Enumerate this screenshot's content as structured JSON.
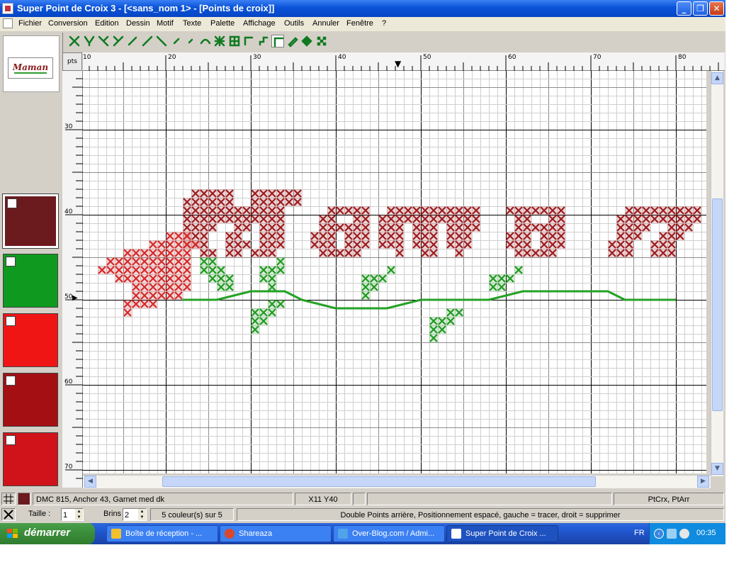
{
  "window": {
    "title": "Super Point de Croix 3 - [<sans_nom 1> - [Points de croix]]",
    "min_glyph": "_",
    "max_glyph": "❐",
    "close_glyph": "✕"
  },
  "menu": {
    "items": [
      "Fichier",
      "Conversion",
      "Edition",
      "Dessin",
      "Motif",
      "Texte",
      "Palette",
      "Affichage",
      "Outils",
      "Annuler",
      "Fenêtre",
      "?"
    ],
    "mdi_min": "–",
    "mdi_restore": "❐",
    "mdi_close": "✕"
  },
  "toolbar": {
    "tools": [
      "cross-full-icon",
      "cross-half-icon",
      "cross-quarter-icon",
      "cross-three-quarter-icon",
      "cross-diag-icon",
      "backstitch-slash-icon",
      "backstitch-backslash-icon",
      "backstitch-short-icon",
      "backstitch-mini-icon",
      "curve-icon",
      "grid-cross-icon",
      "target-icon",
      "corner-icon",
      "step-icon",
      "corner-bold-icon",
      "pencil-icon",
      "fill-icon",
      "dots-icon"
    ]
  },
  "logo": {
    "text": "Maman"
  },
  "palette": {
    "colors": [
      "#6b1a1e",
      "#0f9a1f",
      "#f01515",
      "#a40f14",
      "#d0121a"
    ],
    "selected_index": 0
  },
  "ruler": {
    "unit_label": "pts",
    "top_labels": [
      "10",
      "20",
      "30",
      "40",
      "50",
      "60",
      "70",
      "80"
    ],
    "left_labels": [
      "30",
      "40",
      "50",
      "60",
      "70"
    ],
    "marker_top": "▼",
    "marker_left": "▶"
  },
  "canvas": {
    "thread_colors": {
      "dark_red": "#9c1c1f",
      "red": "#d42a2a",
      "green": "#1f9a1f",
      "stem": "#24a224"
    },
    "text": "Maman"
  },
  "status": {
    "thread_info": "DMC 815, Anchor 43, Garnet med dk",
    "coords": "X11 Y40",
    "mode": "PtCrx, PtArr",
    "size_label": "Taille :",
    "size_value": "1",
    "strands_label": "Brins",
    "strands_value": "2",
    "colors_count": "5 couleur(s) sur 5",
    "hint": "Double Points arrière, Positionnement espacé,  gauche = tracer, droit = supprimer"
  },
  "taskbar": {
    "start": "démarrer",
    "tasks": [
      {
        "label": "Boîte de réception - ...",
        "icon": "outlook-icon",
        "active": false
      },
      {
        "label": "Shareaza",
        "icon": "shareaza-icon",
        "active": false
      },
      {
        "label": "Over-Blog.com / Admi...",
        "icon": "ie-icon",
        "active": false
      },
      {
        "label": "Super Point de Croix ...",
        "icon": "app-icon",
        "active": true
      }
    ],
    "lang": "FR",
    "clock": "00:35"
  }
}
